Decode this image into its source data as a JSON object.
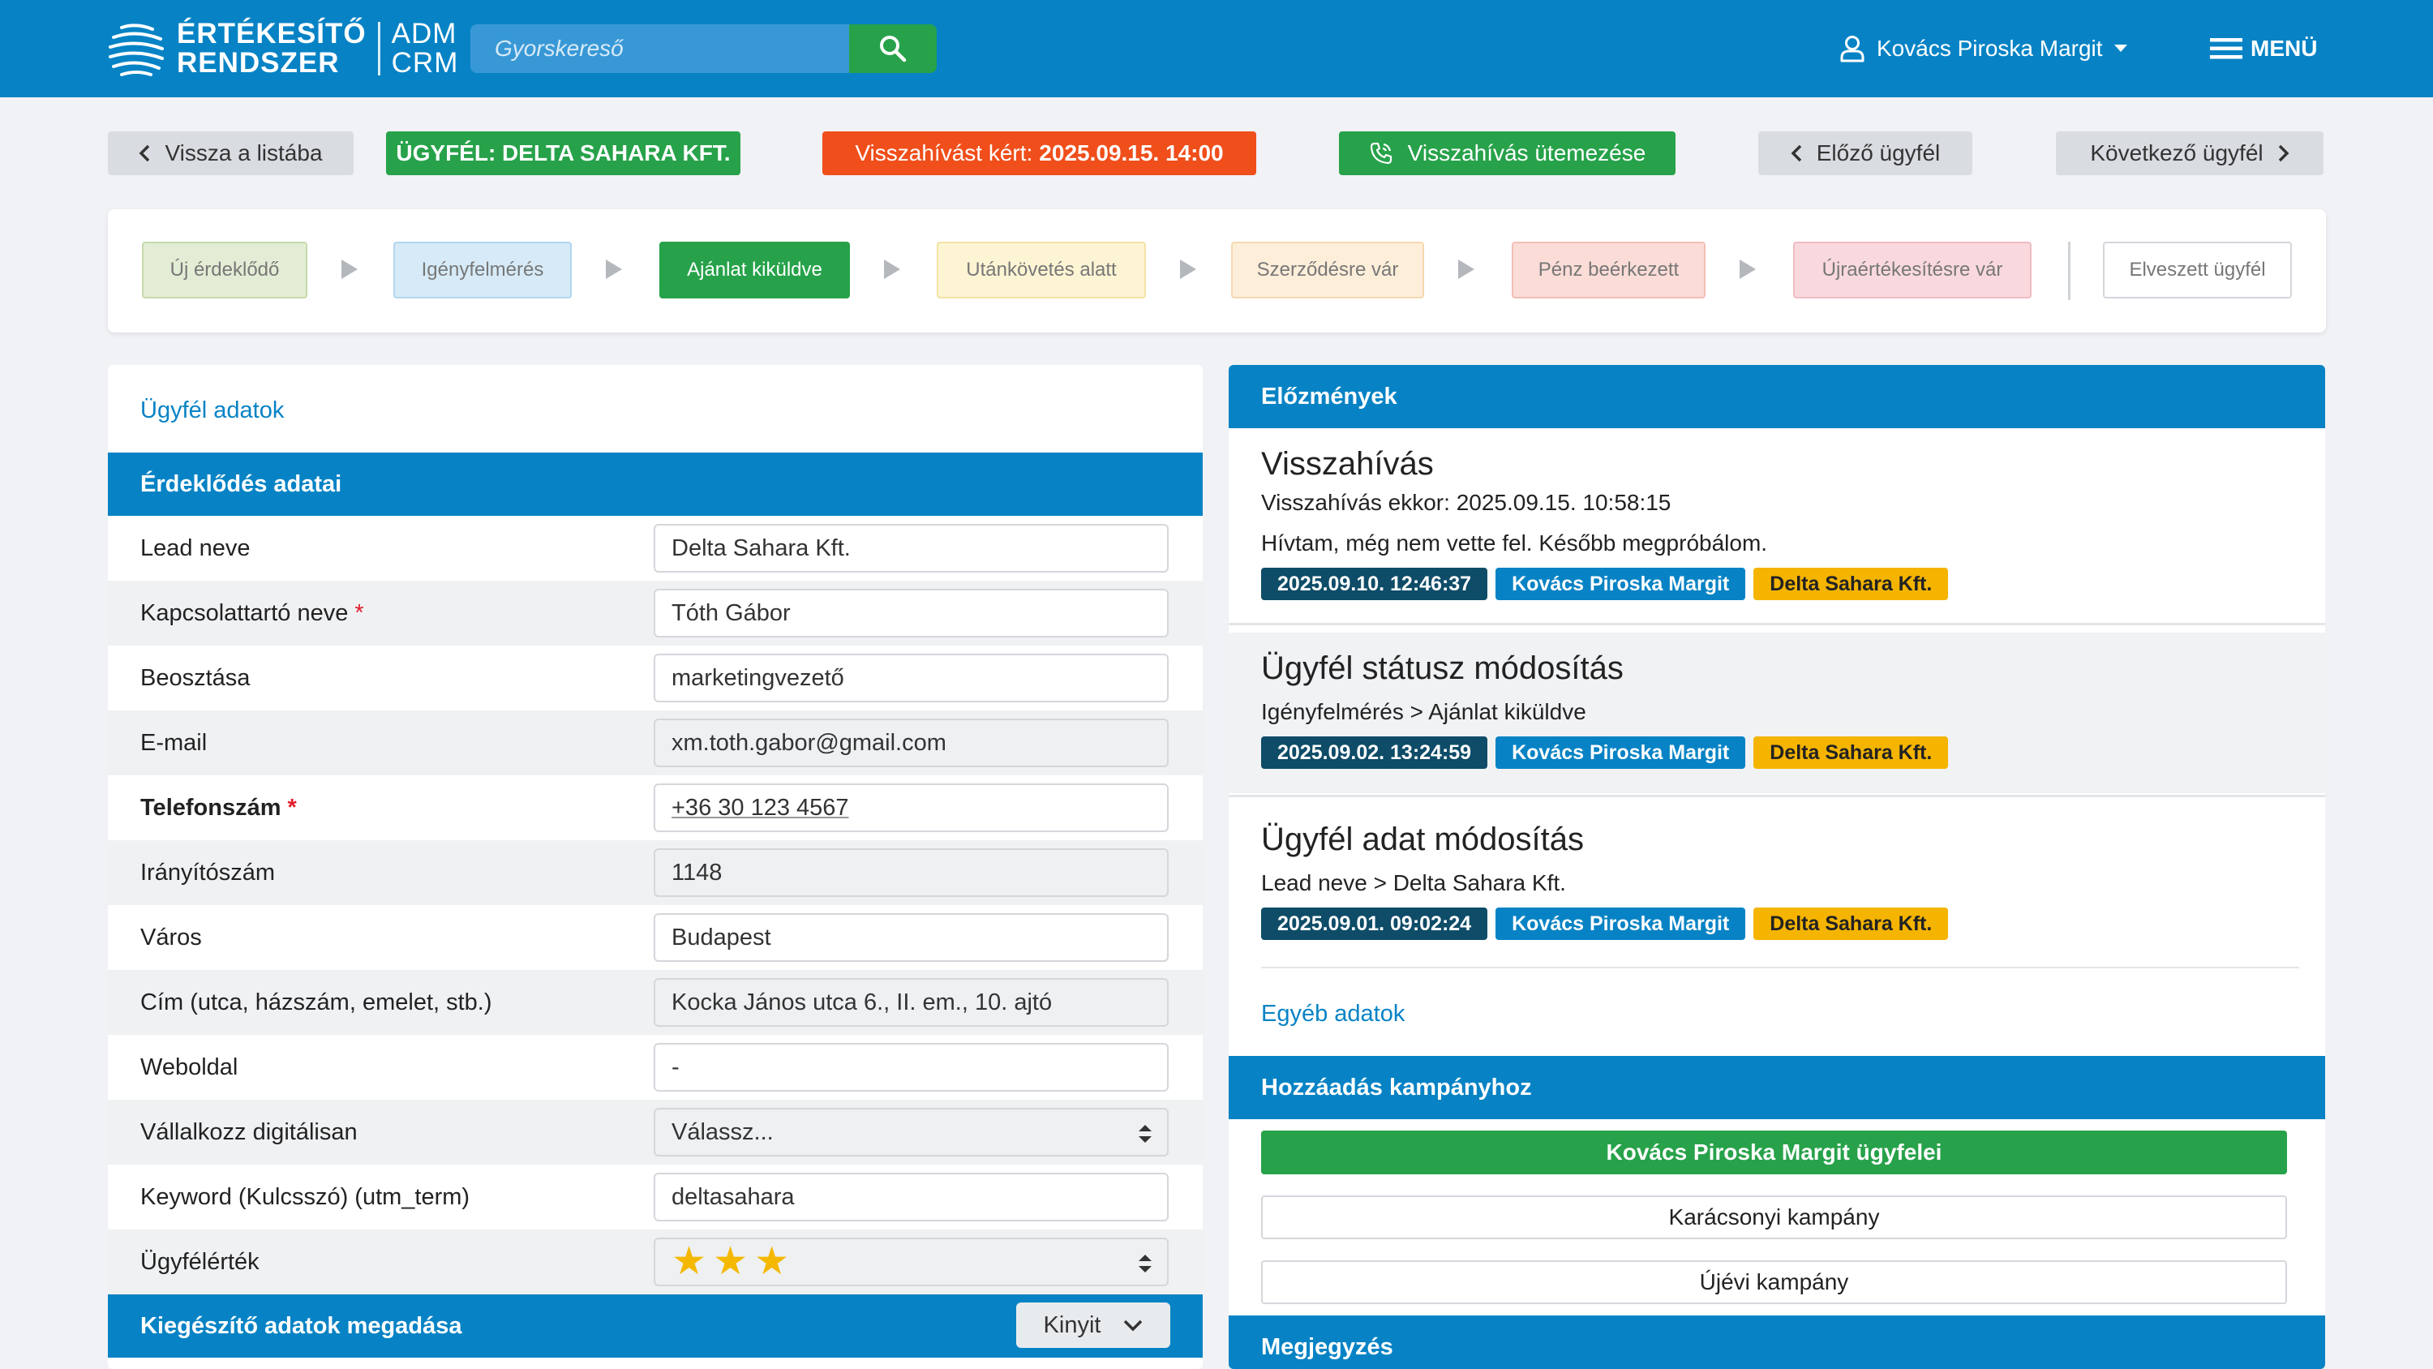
{
  "header": {
    "logo_main_line1": "ÉRTÉKESÍTŐ",
    "logo_main_line2": "RENDSZER",
    "logo_sub_line1": "ADM",
    "logo_sub_line2": "CRM",
    "search_placeholder": "Gyorskereső",
    "user_name": "Kovács Piroska Margit",
    "menu_label": "MENÜ",
    "brand_color": "#0783c5"
  },
  "actions": {
    "back_label": "Vissza a listába",
    "client_label": "ÜGYFÉL: DELTA SAHARA KFT.",
    "callback_requested_prefix": "Visszahívást kért:",
    "callback_requested_time": "2025.09.15. 14:00",
    "schedule_label": "Visszahívás ütemezése",
    "prev_label": "Előző ügyfél",
    "next_label": "Következő ügyfél"
  },
  "pipeline": {
    "stages": [
      {
        "label": "Új érdeklődő",
        "bg": "#e3edd5",
        "border": "#c6d9ad",
        "color": "#777777"
      },
      {
        "label": "Igényfelmérés",
        "bg": "#d6ebf7",
        "border": "#b3d6ee",
        "color": "#777777"
      },
      {
        "label": "Ajánlat kiküldve",
        "bg": "#27a24a",
        "border": "#27a24a",
        "color": "#ffffff",
        "active": true
      },
      {
        "label": "Utánkövetés alatt",
        "bg": "#fdf4d3",
        "border": "#f3e2a3",
        "color": "#777777"
      },
      {
        "label": "Szerződésre vár",
        "bg": "#fdeed9",
        "border": "#f5d9b0",
        "color": "#777777"
      },
      {
        "label": "Pénz beérkezett",
        "bg": "#fbdcd7",
        "border": "#f2bfb6",
        "color": "#777777"
      },
      {
        "label": "Újraértékesítésre vár",
        "bg": "#f9d9dd",
        "border": "#efbcc3",
        "color": "#777777"
      }
    ],
    "lost_label": "Elveszett ügyfél"
  },
  "client_data": {
    "title": "Ügyfél adatok",
    "section_title": "Érdeklődés adatai",
    "fields": [
      {
        "label": "Lead neve",
        "value": "Delta Sahara Kft."
      },
      {
        "label": "Kapcsolattartó neve",
        "value": "Tóth Gábor",
        "required": true
      },
      {
        "label": "Beosztása",
        "value": "marketingvezető"
      },
      {
        "label": "E-mail",
        "value": "xm.toth.gabor@gmail.com",
        "readonly": true
      },
      {
        "label": "Telefonszám",
        "value": "+36 30 123 4567",
        "required": true
      },
      {
        "label": "Irányítószám",
        "value": "1148",
        "readonly": true
      },
      {
        "label": "Város",
        "value": "Budapest"
      },
      {
        "label": "Cím (utca, házszám, emelet, stb.)",
        "value": "Kocka János utca 6., II. em., 10. ajtó",
        "readonly": true
      },
      {
        "label": "Weboldal",
        "value": "-"
      },
      {
        "label": "Vállalkozz digitálisan",
        "value": "Válassz...",
        "readonly": true
      },
      {
        "label": "Keyword (Kulcsszó) (utm_term)",
        "value": "deltasahara"
      },
      {
        "label": "Ügyfélérték",
        "rating": 3,
        "rating_max": 3,
        "readonly": true
      }
    ],
    "extra_section_title": "Kiegészítő adatok megadása",
    "extra_toggle_label": "Kinyit"
  },
  "history": {
    "title": "Előzmények",
    "items": [
      {
        "title": "Visszahívás",
        "lines": [
          "Visszahívás ekkor: 2025.09.15. 10:58:15",
          "Hívtam, még nem vette fel. Később megpróbálom."
        ],
        "date": "2025.09.10. 12:46:37",
        "user": "Kovács Piroska Margit",
        "client": "Delta Sahara Kft."
      },
      {
        "title": "Ügyfél státusz módosítás",
        "lines": [
          "Igényfelmérés > Ajánlat kiküldve"
        ],
        "date": "2025.09.02. 13:24:59",
        "user": "Kovács Piroska Margit",
        "client": "Delta Sahara Kft."
      },
      {
        "title": "Ügyfél adat módosítás",
        "lines": [
          "Lead neve > Delta Sahara Kft."
        ],
        "date": "2025.09.01. 09:02:24",
        "user": "Kovács Piroska Margit",
        "client": "Delta Sahara Kft."
      }
    ],
    "other_data_title": "Egyéb adatok"
  },
  "campaign": {
    "title": "Hozzáadás kampányhoz",
    "buttons": [
      "Kovács Piroska Margit ügyfelei",
      "Karácsonyi kampány",
      "Újévi kampány"
    ]
  },
  "note": {
    "title": "Megjegyzés"
  }
}
